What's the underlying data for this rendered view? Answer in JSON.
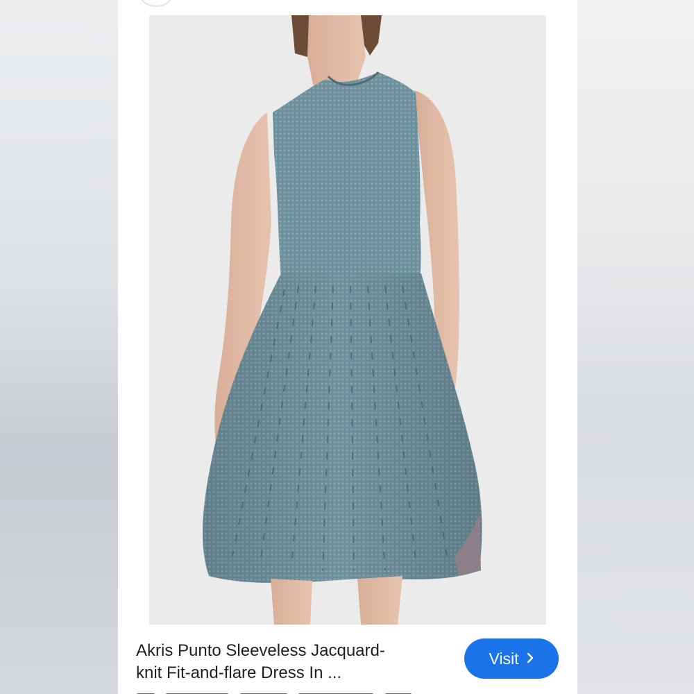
{
  "result": {
    "title_line1": "Akris Punto Sleeveless Jacquard-",
    "title_line2": "knit Fit-and-flare Dress In ...",
    "visit_label": "Visit",
    "visit_icon": "chevron-right-icon"
  },
  "colors": {
    "button": "#1a73e8",
    "dress": "#6f8f9b",
    "background": "#ffffff"
  }
}
